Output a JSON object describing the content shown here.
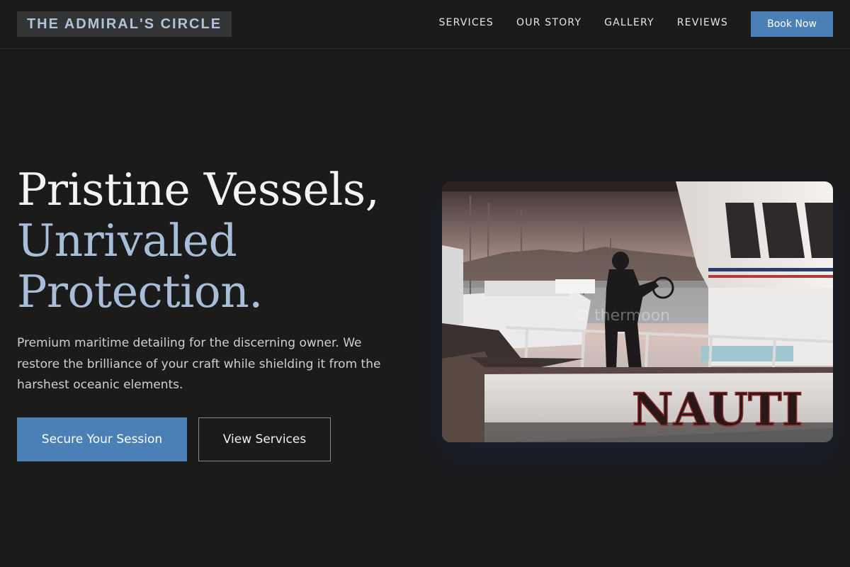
{
  "nav": {
    "brand": "THE ADMIRAL'S CIRCLE",
    "links": [
      "SERVICES",
      "OUR STORY",
      "GALLERY",
      "REVIEWS"
    ],
    "cta": "Book Now"
  },
  "hero": {
    "title_line1": "Pristine Vessels,",
    "title_line2": "Unrivaled",
    "title_line3": "Protection.",
    "description": "Premium maritime detailing for the discerning owner. We restore the brilliance of your craft while shielding it from the harshest oceanic elements.",
    "primary_button": "Secure Your Session",
    "secondary_button": "View Services",
    "image": {
      "boat_name": "NAUTI",
      "watermark": "© thermoon"
    }
  },
  "colors": {
    "background": "#1b1b1c",
    "accent": "#4a80b5",
    "title_accent": "#a8bdd8",
    "brand_text": "#b0c3da"
  }
}
